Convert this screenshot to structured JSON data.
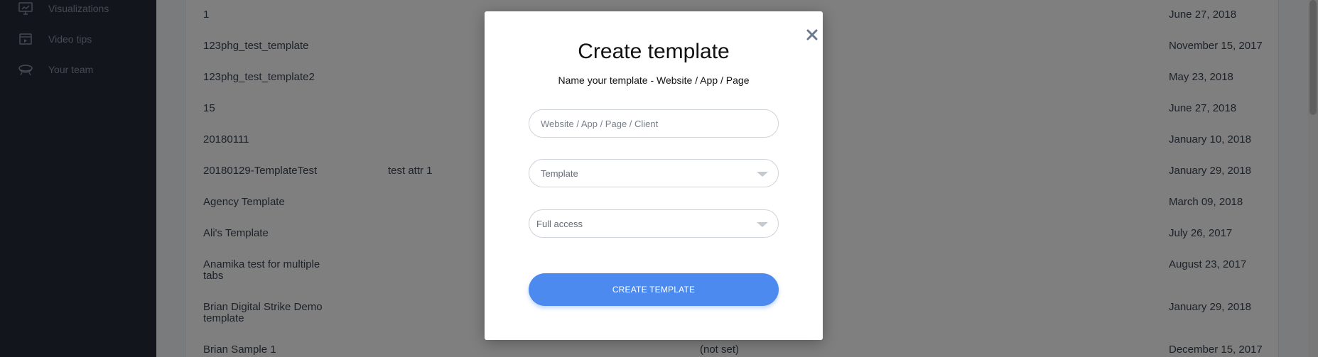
{
  "sidebar": {
    "items": [
      {
        "label": "Visualizations",
        "icon": "visualizations-icon"
      },
      {
        "label": "Video tips",
        "icon": "video-icon"
      },
      {
        "label": "Your team",
        "icon": "team-icon"
      }
    ]
  },
  "table": {
    "rows": [
      {
        "name": "1",
        "attr": "",
        "mid": "",
        "date": "June 27, 2018"
      },
      {
        "name": "123phg_test_template",
        "attr": "",
        "mid": "",
        "date": "November 15, 2017"
      },
      {
        "name": "123phg_test_template2",
        "attr": "",
        "mid": "",
        "date": "May 23, 2018"
      },
      {
        "name": "15",
        "attr": "",
        "mid": "",
        "date": "June 27, 2018"
      },
      {
        "name": "20180111",
        "attr": "",
        "mid": "",
        "date": "January 10, 2018"
      },
      {
        "name": "20180129-TemplateTest",
        "attr": "test attr 1",
        "mid": "",
        "date": "January 29, 2018"
      },
      {
        "name": "Agency Template",
        "attr": "",
        "mid": "",
        "date": "March 09, 2018"
      },
      {
        "name": "Ali's Template",
        "attr": "",
        "mid": "",
        "date": "July 26, 2017"
      },
      {
        "name": "Anamika test for multiple tabs",
        "attr": "",
        "mid": "",
        "date": "August 23, 2017"
      },
      {
        "name": "Brian Digital Strike Demo template",
        "attr": "",
        "mid": "",
        "date": "January 29, 2018"
      },
      {
        "name": "Brian Sample 1",
        "attr": "",
        "mid": "(not set)",
        "date": "December 15, 2017"
      }
    ]
  },
  "modal": {
    "title": "Create template",
    "subtitle": "Name your template - Website / App / Page",
    "name_placeholder": "Website / App / Page / Client",
    "template_select": "Template",
    "access_select": "Full access",
    "create_button": "CREATE TEMPLATE",
    "close_icon": "close-icon"
  },
  "colors": {
    "sidebar_bg": "#252c38",
    "accent": "#4d8af0",
    "overlay": "rgba(0,0,0,0.5)"
  }
}
